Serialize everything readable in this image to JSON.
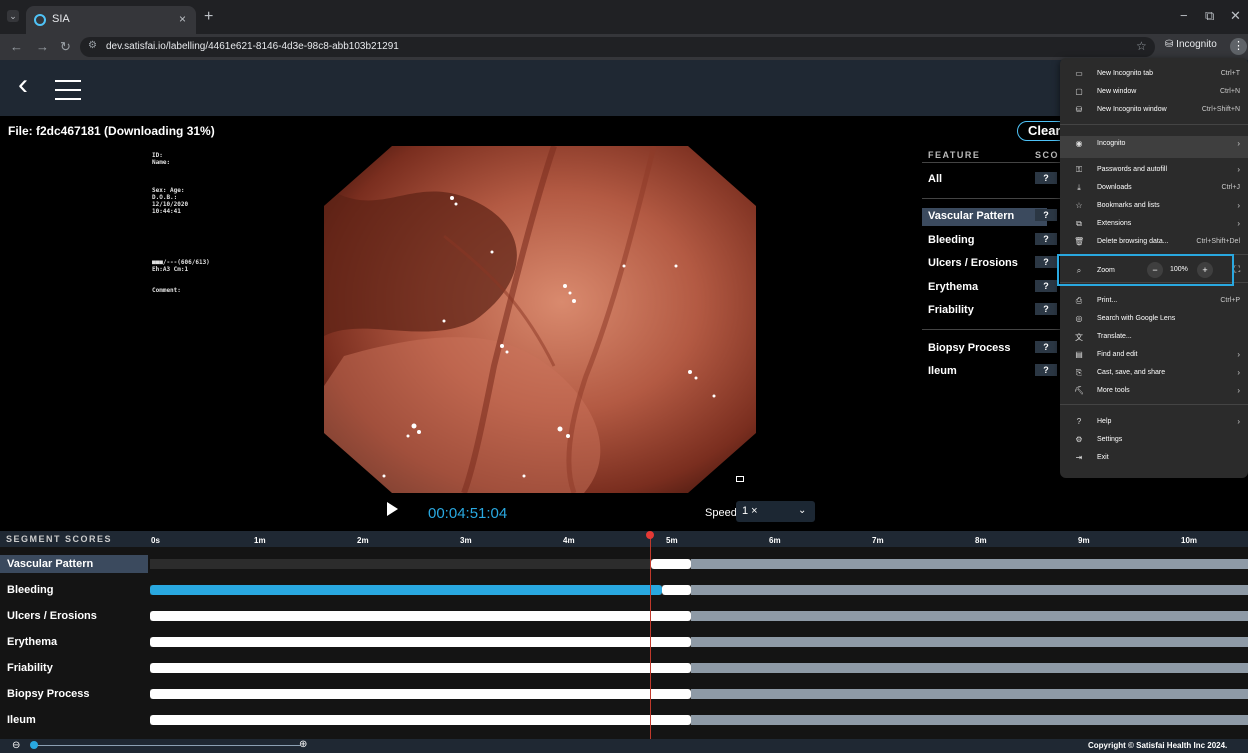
{
  "browser": {
    "tab_title": "SIA",
    "tab_close": "×",
    "new_tab": "+",
    "url": "dev.satisfai.io/labelling/4461e621-8146-4d3e-98c8-abb103b21291",
    "incognito_label": "Incognito",
    "window_minimize": "−",
    "window_restore": "⧉",
    "window_close": "✕"
  },
  "app": {
    "file_title": "File: f2dc467181 (Downloading 31%)",
    "clear_label": "Clear",
    "overlay": {
      "id": "ID:",
      "name": "Name:",
      "sex_age": "Sex:  Age:",
      "dob": "D.O.B.:",
      "date": "12/10/2020",
      "time": "10:44:41",
      "status": "■■■/---(606/613)",
      "eh": "Eh:A3 Cm:1",
      "comment": "Comment:"
    },
    "timecode": "00:04:51:04",
    "speed_label": "Speed",
    "speed_value": "1 ×",
    "copyright": "Copyright © Satisfai Health Inc 2024."
  },
  "features": {
    "header_feature": "FEATURE",
    "header_score": "SCO",
    "items": [
      {
        "name": "All",
        "score": "?"
      },
      {
        "name": "Vascular Pattern",
        "score": "?"
      },
      {
        "name": "Bleeding",
        "score": "?"
      },
      {
        "name": "Ulcers / Erosions",
        "score": "?"
      },
      {
        "name": "Erythema",
        "score": "?"
      },
      {
        "name": "Friability",
        "score": "?"
      },
      {
        "name": "Biopsy Process",
        "score": "?"
      },
      {
        "name": "Ileum",
        "score": "?"
      }
    ]
  },
  "segments": {
    "header": "SEGMENT SCORES",
    "ticks": [
      "0s",
      "1m",
      "2m",
      "3m",
      "4m",
      "5m",
      "6m",
      "7m",
      "8m",
      "9m",
      "10m"
    ],
    "rows": [
      {
        "label": "Vascular Pattern",
        "fill_end": 0.0,
        "fill_color": "#ffffff",
        "white_start": 0.456,
        "white_end": 0.493,
        "active": true
      },
      {
        "label": "Bleeding",
        "fill_end": 0.466,
        "fill_color": "#29a8e0",
        "white_start": 0.466,
        "white_end": 0.493,
        "active": false
      },
      {
        "label": "Ulcers / Erosions",
        "fill_end": 0.493,
        "fill_color": "#ffffff",
        "white_start": 0,
        "white_end": 0,
        "active": false
      },
      {
        "label": "Erythema",
        "fill_end": 0.493,
        "fill_color": "#ffffff",
        "white_start": 0,
        "white_end": 0,
        "active": false
      },
      {
        "label": "Friability",
        "fill_end": 0.493,
        "fill_color": "#ffffff",
        "white_start": 0,
        "white_end": 0,
        "active": false
      },
      {
        "label": "Biopsy Process",
        "fill_end": 0.493,
        "fill_color": "#ffffff",
        "white_start": 0,
        "white_end": 0,
        "active": false
      },
      {
        "label": "Ileum",
        "fill_end": 0.493,
        "fill_color": "#ffffff",
        "white_start": 0,
        "white_end": 0,
        "active": false
      }
    ]
  },
  "menu": {
    "items": [
      {
        "icon": "▭",
        "label": "New Incognito tab",
        "shortcut": "Ctrl+T"
      },
      {
        "icon": "▢",
        "label": "New window",
        "shortcut": "Ctrl+N"
      },
      {
        "icon": "⛁",
        "label": "New Incognito window",
        "shortcut": "Ctrl+Shift+N"
      },
      {
        "icon": "◉",
        "label": "Incognito",
        "shortcut": "›"
      },
      {
        "icon": "⚿",
        "label": "Passwords and autofill",
        "shortcut": "›"
      },
      {
        "icon": "⤓",
        "label": "Downloads",
        "shortcut": "Ctrl+J"
      },
      {
        "icon": "☆",
        "label": "Bookmarks and lists",
        "shortcut": "›"
      },
      {
        "icon": "⧉",
        "label": "Extensions",
        "shortcut": "›"
      },
      {
        "icon": "🗑",
        "label": "Delete browsing data...",
        "shortcut": "Ctrl+Shift+Del"
      },
      {
        "icon": "⌕",
        "label": "Zoom",
        "shortcut": ""
      },
      {
        "icon": "⎙",
        "label": "Print...",
        "shortcut": "Ctrl+P"
      },
      {
        "icon": "◎",
        "label": "Search with Google Lens",
        "shortcut": ""
      },
      {
        "icon": "文",
        "label": "Translate...",
        "shortcut": ""
      },
      {
        "icon": "▤",
        "label": "Find and edit",
        "shortcut": "›"
      },
      {
        "icon": "⎘",
        "label": "Cast, save, and share",
        "shortcut": "›"
      },
      {
        "icon": "⛏",
        "label": "More tools",
        "shortcut": "›"
      },
      {
        "icon": "?",
        "label": "Help",
        "shortcut": "›"
      },
      {
        "icon": "⚙",
        "label": "Settings",
        "shortcut": ""
      },
      {
        "icon": "⇥",
        "label": "Exit",
        "shortcut": ""
      }
    ],
    "zoom_value": "100%",
    "zoom_minus": "−",
    "zoom_plus": "+"
  }
}
